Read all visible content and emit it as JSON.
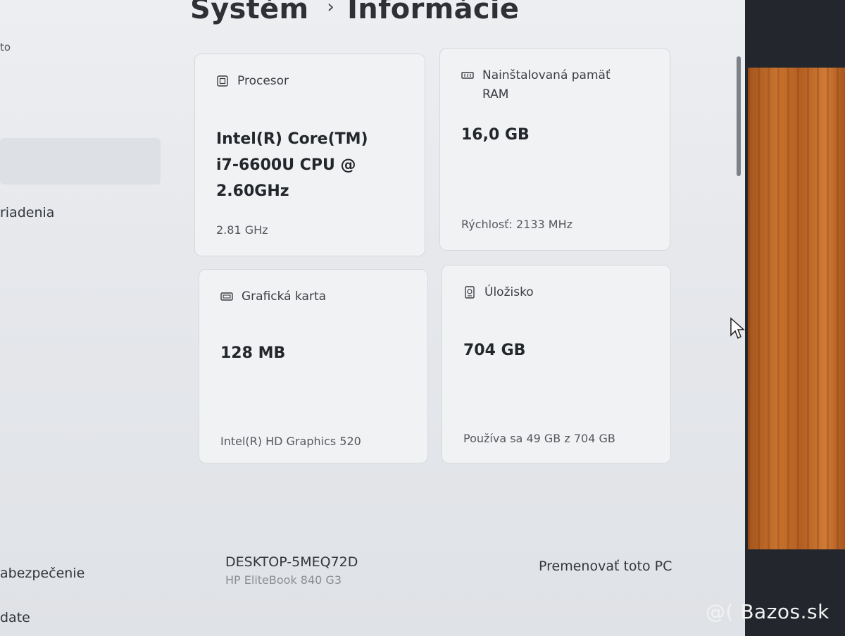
{
  "sidebar": {
    "items": [
      {
        "label": "to"
      },
      {
        "label": "riadenia"
      },
      {
        "label": "abezpečenie"
      },
      {
        "label": "date"
      }
    ]
  },
  "breadcrumb": {
    "parent": "Systém",
    "separator": "›",
    "current": "Informácie"
  },
  "cards": {
    "processor": {
      "title": "Procesor",
      "value_lines": [
        "Intel(R) Core(TM)",
        "i7-6600U CPU @",
        "2.60GHz"
      ],
      "sub": "2.81 GHz",
      "icon": "cpu-icon"
    },
    "ram": {
      "title_lines": [
        "Nainštalovaná pamäť",
        "RAM"
      ],
      "value": "16,0 GB",
      "sub": "Rýchlosť: 2133 MHz",
      "icon": "memory-icon"
    },
    "gpu": {
      "title": "Grafická karta",
      "value": "128 MB",
      "sub": "Intel(R) HD Graphics 520",
      "icon": "display-adapter-icon"
    },
    "storage": {
      "title": "Úložisko",
      "value": "704 GB",
      "sub": "Používa sa 49 GB z 704 GB",
      "icon": "storage-drive-icon"
    }
  },
  "device": {
    "name": "DESKTOP-5MEQ72D",
    "model": "HP EliteBook 840 G3",
    "rename_label": "Premenovať toto PC"
  },
  "watermark": "@( Bazos.sk"
}
